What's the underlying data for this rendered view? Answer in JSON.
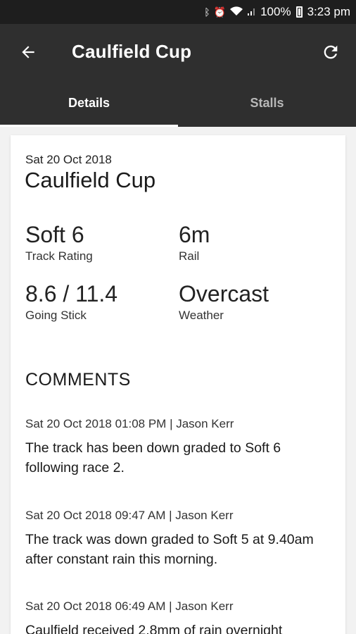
{
  "status_bar": {
    "battery": "100%",
    "time": "3:23 pm"
  },
  "toolbar": {
    "title": "Caulfield Cup"
  },
  "tabs": [
    {
      "label": "Details",
      "active": true
    },
    {
      "label": "Stalls",
      "active": false
    }
  ],
  "race": {
    "date": "Sat 20 Oct 2018",
    "name": "Caulfield Cup"
  },
  "stats": {
    "track_rating": {
      "value": "Soft 6",
      "label": "Track Rating"
    },
    "rail": {
      "value": "6m",
      "label": "Rail"
    },
    "going_stick": {
      "value": "8.6 / 11.4",
      "label": "Going Stick"
    },
    "weather": {
      "value": "Overcast",
      "label": "Weather"
    }
  },
  "comments": {
    "heading": "COMMENTS",
    "items": [
      {
        "meta": "Sat 20 Oct 2018 01:08 PM | Jason Kerr",
        "text": "The track has been down graded to Soft 6 following race 2."
      },
      {
        "meta": "Sat 20 Oct 2018 09:47 AM | Jason Kerr",
        "text": "The track was down graded to Soft 5 at 9.40am after constant rain this morning."
      },
      {
        "meta": "Sat 20 Oct 2018 06:49 AM | Jason Kerr",
        "text": "Caulfield received 2.8mm of rain overnight"
      }
    ]
  }
}
